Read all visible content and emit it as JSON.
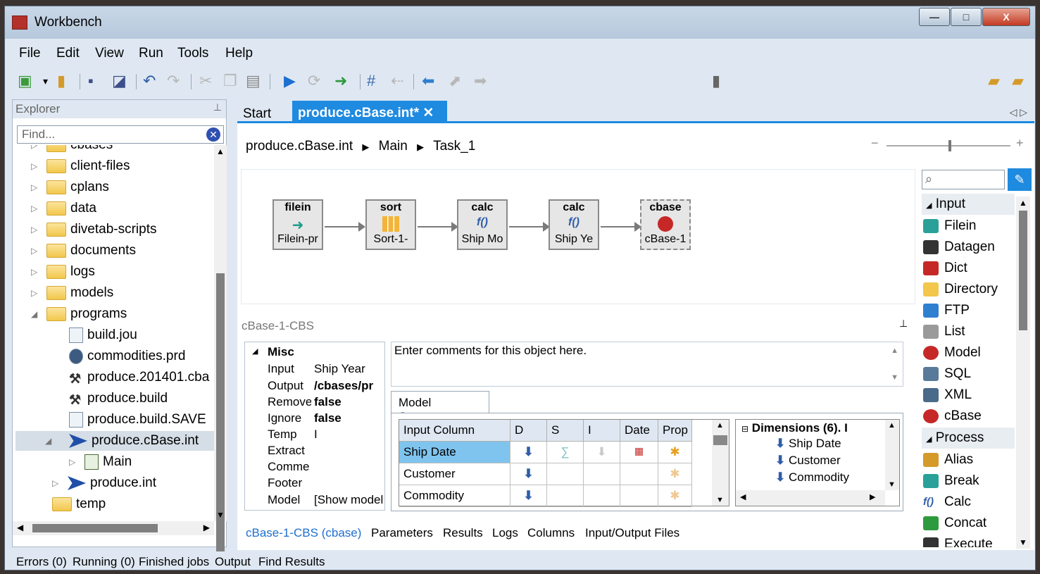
{
  "window": {
    "title": "Workbench",
    "controls": [
      "—",
      "□",
      "X"
    ]
  },
  "menu": [
    "File",
    "Edit",
    "View",
    "Run",
    "Tools",
    "Help"
  ],
  "toolbar": {
    "combo_value": ""
  },
  "explorer": {
    "title": "Explorer",
    "find_placeholder": "Find...",
    "items": [
      {
        "label": "cbases"
      },
      {
        "label": "client-files"
      },
      {
        "label": "cplans"
      },
      {
        "label": "data"
      },
      {
        "label": "divetab-scripts"
      },
      {
        "label": "documents"
      },
      {
        "label": "logs"
      },
      {
        "label": "models"
      },
      {
        "label": "programs"
      },
      {
        "label": "build.jou"
      },
      {
        "label": "commodities.prd"
      },
      {
        "label": "produce.201401.cba"
      },
      {
        "label": "produce.build"
      },
      {
        "label": "produce.build.SAVE"
      },
      {
        "label": "produce.cBase.int"
      },
      {
        "label": "Main"
      },
      {
        "label": "produce.int"
      },
      {
        "label": "temp"
      }
    ]
  },
  "tabs": {
    "start": "Start",
    "active": "produce.cBase.int*",
    "close": "✕",
    "nav": "◁ ▷"
  },
  "breadcrumb": [
    "produce.cBase.int",
    "Main",
    "Task_1"
  ],
  "nodes": [
    {
      "type": "filein",
      "label": "Filein-pr"
    },
    {
      "type": "sort",
      "label": "Sort-1-"
    },
    {
      "type": "calc",
      "label": "Ship Mo"
    },
    {
      "type": "calc",
      "label": "Ship Ye"
    },
    {
      "type": "cbase",
      "label": "cBase-1"
    }
  ],
  "props": {
    "title": "cBase-1-CBS",
    "group": "Misc",
    "rows": [
      {
        "key": "Input",
        "value": "Ship Year"
      },
      {
        "key": "Output",
        "value": "/cbases/pr"
      },
      {
        "key": "Remove",
        "value": "false"
      },
      {
        "key": "Ignore",
        "value": "false"
      },
      {
        "key": "Temp",
        "value": "I"
      },
      {
        "key": "Extract",
        "value": ""
      },
      {
        "key": "Comme",
        "value": ""
      },
      {
        "key": "Footer",
        "value": ""
      },
      {
        "key": "Model",
        "value": "[Show model"
      }
    ],
    "comments": "Enter comments for this object here."
  },
  "model_structure": {
    "tab": "Model Structure",
    "columns": [
      "Input Column",
      "D",
      "S",
      "I",
      "Date",
      "Prop"
    ],
    "rows": [
      "Ship Date",
      "Customer",
      "Commodity"
    ],
    "dimensions": {
      "title": "Dimensions (6). I",
      "items": [
        "Ship Date",
        "Customer",
        "Commodity"
      ]
    }
  },
  "bottom_tabs": [
    "cBase-1-CBS (cbase)",
    "Parameters",
    "Results",
    "Logs",
    "Columns",
    "Input/Output Files"
  ],
  "palette": {
    "categories": [
      {
        "name": "Input",
        "items": [
          "Filein",
          "Datagen",
          "Dict",
          "Directory",
          "FTP",
          "List",
          "Model",
          "SQL",
          "XML",
          "cBase"
        ]
      },
      {
        "name": "Process",
        "items": [
          "Alias",
          "Break",
          "Calc",
          "Concat",
          "Execute"
        ]
      }
    ]
  },
  "status": [
    "Errors (0)",
    "Running (0)",
    "Finished jobs",
    "Output",
    "Find Results"
  ]
}
